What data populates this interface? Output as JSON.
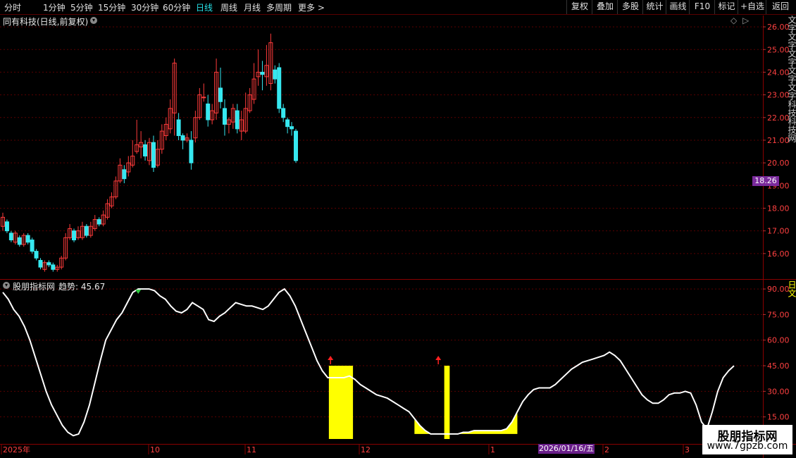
{
  "toolbar": {
    "periods": [
      "分时",
      "1分钟",
      "5分钟",
      "15分钟",
      "30分钟",
      "60分钟",
      "日线",
      "周线",
      "月线",
      "多周期",
      "更多 >"
    ],
    "active": "日线",
    "right_buttons": [
      "复权",
      "叠加",
      "多股",
      "统计",
      "画线",
      "F10",
      "标记",
      "+自选",
      "返回"
    ]
  },
  "main_chart": {
    "title": "同有科技(日线,前复权)",
    "current_price": "18.26",
    "up_color": "#ff3b3b",
    "down_color": "#36e8f0",
    "side_text": "文字文字文字文字文字科技科技网"
  },
  "indicator": {
    "title": "股朋指标网",
    "trend_label": "趋势: 45.67",
    "line_color": "#ffffff",
    "bar_color": "#ffff00",
    "arrow_color": "#ff2020",
    "side_text": "日文"
  },
  "date_axis": {
    "labels": [
      "2025年",
      "10",
      "11",
      "12",
      "1",
      "2",
      "3"
    ],
    "highlight": "2026/01/16/五"
  },
  "watermark": {
    "line1": "股朋指标网",
    "line2": "www.7gpzb.com"
  },
  "chart_data": [
    {
      "type": "candlestick",
      "title": "同有科技(日线,前复权)",
      "ylim": [
        15.0,
        26.5
      ],
      "yticks": [
        16.0,
        17.0,
        18.0,
        19.0,
        20.0,
        21.0,
        22.0,
        23.0,
        24.0,
        25.0,
        26.0
      ],
      "candles": [
        [
          17.2,
          17.6,
          17.8,
          17.0
        ],
        [
          17.4,
          17.0,
          17.5,
          16.9
        ],
        [
          16.9,
          16.6,
          17.0,
          16.5
        ],
        [
          16.5,
          16.9,
          17.0,
          16.4
        ],
        [
          16.7,
          16.4,
          16.8,
          16.3
        ],
        [
          16.4,
          16.8,
          16.9,
          16.3
        ],
        [
          16.8,
          16.5,
          16.9,
          16.4
        ],
        [
          16.6,
          16.1,
          16.7,
          16.0
        ],
        [
          16.1,
          15.8,
          16.2,
          15.7
        ],
        [
          15.7,
          15.4,
          15.8,
          15.3
        ],
        [
          15.3,
          15.6,
          15.7,
          15.2
        ],
        [
          15.6,
          15.5,
          15.7,
          15.4
        ],
        [
          15.5,
          15.3,
          15.6,
          15.2
        ],
        [
          15.3,
          15.4,
          15.5,
          15.2
        ],
        [
          15.4,
          15.8,
          15.9,
          15.3
        ],
        [
          15.8,
          16.7,
          16.9,
          15.7
        ],
        [
          16.7,
          17.1,
          17.3,
          16.6
        ],
        [
          17.0,
          16.6,
          17.1,
          16.5
        ],
        [
          16.7,
          17.0,
          17.2,
          16.6
        ],
        [
          16.7,
          17.2,
          17.4,
          16.6
        ],
        [
          17.2,
          16.8,
          17.3,
          16.7
        ],
        [
          16.8,
          17.2,
          17.4,
          16.7
        ],
        [
          17.1,
          17.5,
          17.7,
          17.0
        ],
        [
          17.5,
          17.3,
          17.6,
          17.2
        ],
        [
          17.3,
          17.7,
          17.9,
          17.2
        ],
        [
          17.6,
          18.2,
          18.4,
          17.5
        ],
        [
          18.1,
          18.5,
          18.7,
          18.0
        ],
        [
          18.5,
          19.2,
          19.4,
          18.4
        ],
        [
          19.2,
          19.9,
          20.2,
          19.1
        ],
        [
          19.7,
          19.3,
          19.9,
          19.1
        ],
        [
          19.6,
          20.0,
          20.3,
          19.4
        ],
        [
          19.9,
          20.3,
          21.0,
          19.8
        ],
        [
          20.5,
          20.8,
          21.9,
          20.4
        ],
        [
          20.7,
          20.9,
          21.4,
          20.2
        ],
        [
          20.8,
          20.3,
          21.0,
          20.1
        ],
        [
          20.1,
          20.9,
          21.1,
          19.9
        ],
        [
          20.9,
          19.8,
          21.2,
          19.6
        ],
        [
          19.9,
          20.6,
          21.0,
          19.8
        ],
        [
          20.6,
          21.4,
          21.7,
          20.4
        ],
        [
          21.2,
          21.7,
          22.0,
          21.0
        ],
        [
          21.5,
          22.4,
          22.8,
          21.3
        ],
        [
          22.2,
          24.4,
          24.6,
          21.2
        ],
        [
          21.9,
          21.2,
          22.2,
          21.0
        ],
        [
          21.2,
          21.0,
          21.3,
          20.6
        ],
        [
          21.0,
          21.1,
          21.3,
          20.9
        ],
        [
          21.0,
          20.0,
          21.4,
          19.7
        ],
        [
          21.1,
          22.0,
          22.3,
          20.9
        ],
        [
          22.0,
          23.0,
          23.3,
          21.9
        ],
        [
          22.9,
          22.9,
          23.5,
          22.7
        ],
        [
          22.6,
          21.9,
          23.0,
          21.6
        ],
        [
          21.9,
          22.3,
          22.6,
          21.7
        ],
        [
          22.2,
          24.0,
          24.6,
          21.9
        ],
        [
          23.3,
          22.7,
          24.2,
          22.4
        ],
        [
          22.4,
          21.7,
          22.8,
          21.2
        ],
        [
          21.7,
          21.9,
          22.0,
          21.3
        ],
        [
          21.8,
          22.4,
          22.6,
          21.5
        ],
        [
          22.3,
          21.5,
          22.6,
          21.3
        ],
        [
          21.4,
          21.9,
          22.3,
          21.0
        ],
        [
          21.4,
          22.4,
          23.1,
          21.3
        ],
        [
          22.3,
          23.0,
          23.3,
          22.2
        ],
        [
          22.8,
          23.7,
          24.4,
          22.6
        ],
        [
          23.8,
          24.0,
          25.0,
          23.4
        ],
        [
          24.0,
          23.9,
          24.5,
          23.2
        ],
        [
          23.8,
          24.3,
          25.2,
          23.4
        ],
        [
          23.5,
          25.3,
          25.7,
          23.2
        ],
        [
          24.1,
          23.7,
          24.3,
          23.5
        ],
        [
          24.2,
          22.4,
          24.4,
          22.2
        ],
        [
          22.4,
          22.0,
          22.6,
          21.8
        ],
        [
          21.9,
          21.6,
          22.0,
          21.3
        ],
        [
          21.6,
          21.5,
          21.8,
          21.2
        ],
        [
          21.4,
          20.1,
          21.5,
          20.0
        ]
      ]
    },
    {
      "type": "line",
      "title": "股朋指标网",
      "series_label": "趋势",
      "current_value": 45.67,
      "ylim": [
        0,
        95
      ],
      "yticks": [
        15.0,
        30.0,
        45.0,
        60.0,
        75.0,
        90.0
      ],
      "values": [
        88,
        84,
        78,
        74,
        68,
        60,
        50,
        40,
        30,
        22,
        16,
        10,
        6,
        4,
        5,
        12,
        22,
        35,
        48,
        60,
        66,
        72,
        76,
        82,
        88,
        90,
        90,
        90,
        89,
        86,
        84,
        80,
        77,
        76,
        78,
        82,
        80,
        78,
        72,
        71,
        74,
        76,
        79,
        82,
        81,
        80,
        80,
        79,
        78,
        80,
        84,
        88,
        90,
        86,
        80,
        72,
        64,
        56,
        48,
        42,
        38,
        38,
        38,
        38,
        39,
        37,
        34,
        32,
        30,
        28,
        27,
        26,
        24,
        22,
        20,
        18,
        14,
        10,
        7,
        5,
        5,
        5,
        5,
        5,
        5,
        6,
        6,
        7,
        7,
        7,
        7,
        7,
        7,
        8,
        12,
        18,
        24,
        28,
        31,
        32,
        32,
        32,
        34,
        37,
        40,
        43,
        45,
        47,
        48,
        49,
        50,
        51,
        53,
        51,
        48,
        43,
        38,
        33,
        28,
        25,
        23,
        23,
        25,
        28,
        29,
        29,
        30,
        29,
        22,
        12,
        8,
        18,
        30,
        38,
        42,
        45
      ],
      "signal_bars": [
        {
          "from": 60.2,
          "to": 78.0,
          "value": 45
        },
        {
          "from": 81.5,
          "to": 85.5,
          "value": 45
        }
      ],
      "arrows": [
        {
          "x": 60.5
        },
        {
          "x": 80.4
        }
      ]
    }
  ]
}
